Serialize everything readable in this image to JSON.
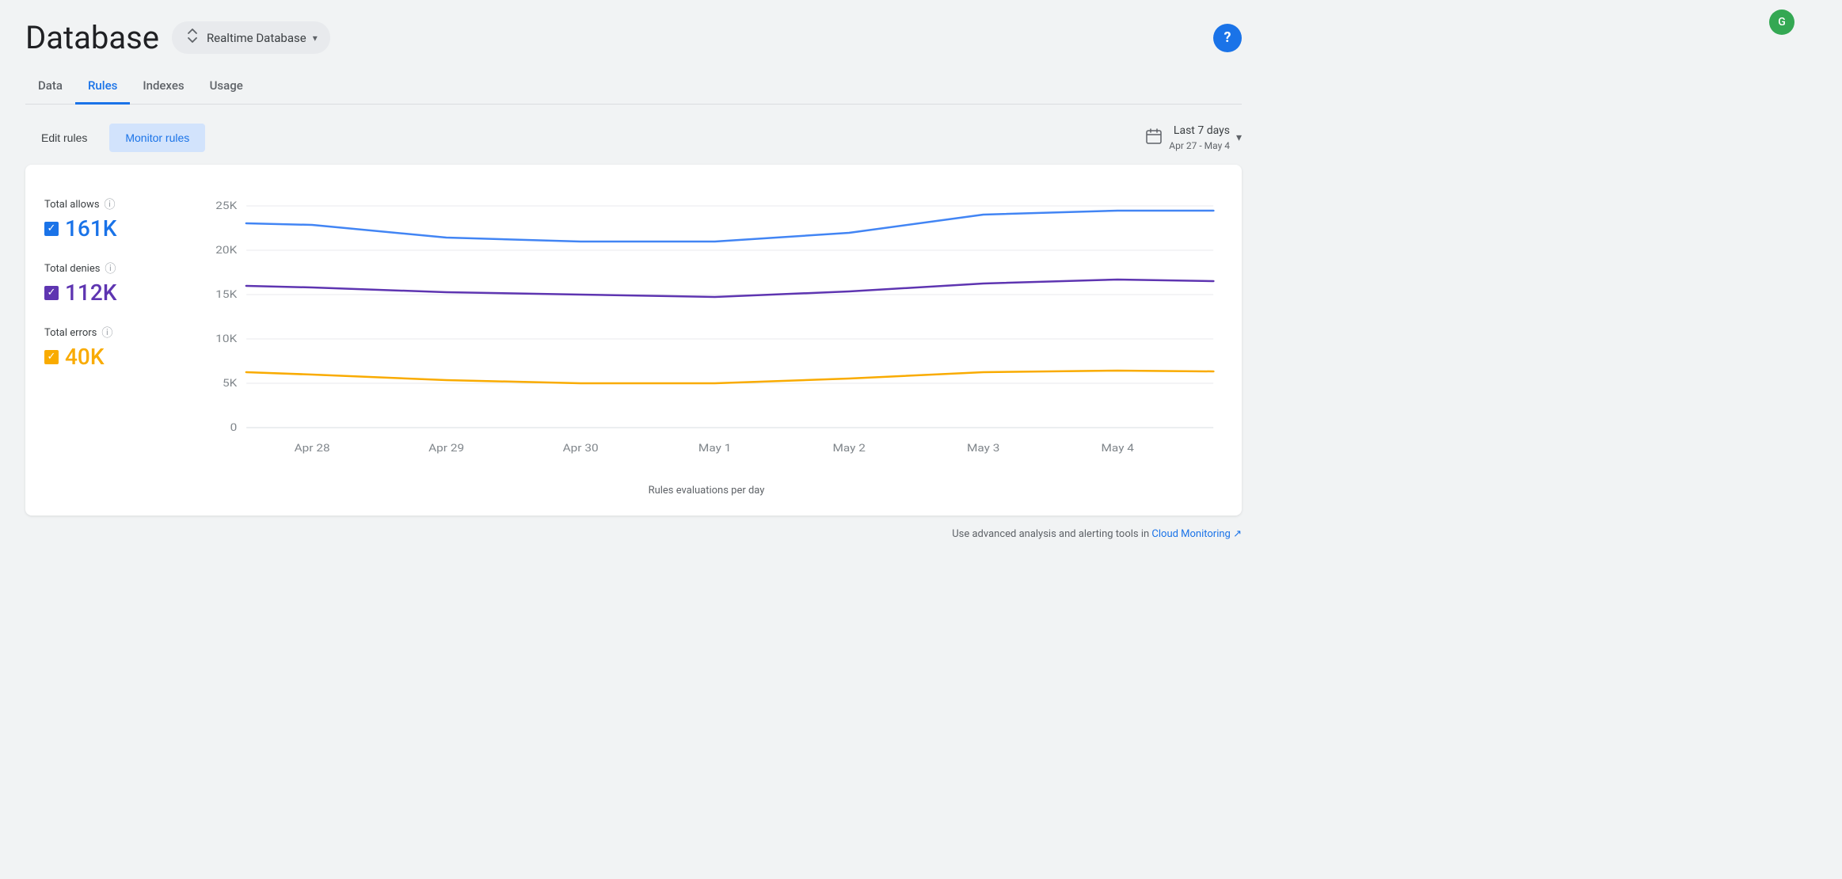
{
  "page": {
    "title": "Database"
  },
  "db_selector": {
    "label": "Realtime Database",
    "icon": "⇌"
  },
  "help_button": {
    "label": "?"
  },
  "tabs": [
    {
      "id": "data",
      "label": "Data",
      "active": false
    },
    {
      "id": "rules",
      "label": "Rules",
      "active": true
    },
    {
      "id": "indexes",
      "label": "Indexes",
      "active": false
    },
    {
      "id": "usage",
      "label": "Usage",
      "active": false
    }
  ],
  "controls": {
    "edit_rules_label": "Edit rules",
    "monitor_rules_label": "Monitor rules",
    "date_range_main": "Last 7 days",
    "date_range_sub": "Apr 27 - May 4"
  },
  "chart": {
    "title": "Rules evaluations per day",
    "y_labels": [
      "25K",
      "20K",
      "15K",
      "10K",
      "5K",
      "0"
    ],
    "x_labels": [
      "Apr 28",
      "Apr 29",
      "Apr 30",
      "May 1",
      "May 2",
      "May 3",
      "May 4"
    ],
    "series": [
      {
        "name": "Total allows",
        "value": "161K",
        "color": "#4285f4",
        "colorName": "blue",
        "points": [
          0.92,
          0.82,
          0.79,
          0.78,
          0.8,
          0.93,
          0.97,
          0.98
        ]
      },
      {
        "name": "Total denies",
        "value": "112K",
        "color": "#5e35b1",
        "colorName": "purple",
        "points": [
          0.61,
          0.57,
          0.54,
          0.55,
          0.55,
          0.62,
          0.65,
          0.64
        ]
      },
      {
        "name": "Total errors",
        "value": "40K",
        "color": "#f9ab00",
        "colorName": "yellow",
        "points": [
          0.23,
          0.22,
          0.2,
          0.19,
          0.2,
          0.22,
          0.23,
          0.23
        ]
      }
    ]
  },
  "footer": {
    "note_text": "Use advanced analysis and alerting tools in ",
    "link_text": "Cloud Monitoring",
    "external_icon": "↗"
  }
}
